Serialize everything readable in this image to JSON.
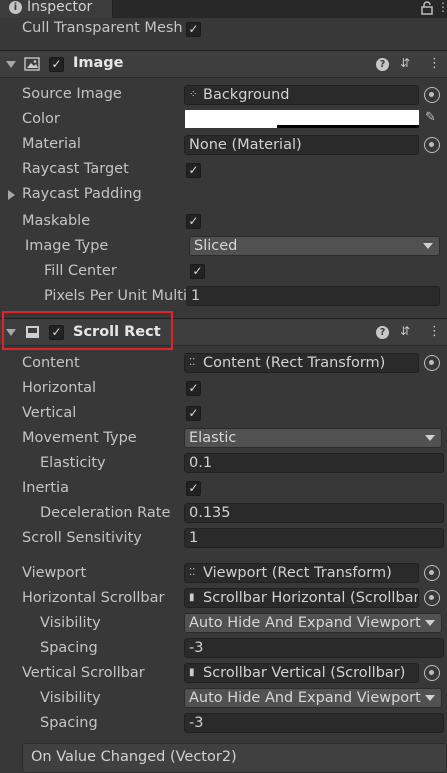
{
  "window": {
    "tab_label": "Inspector",
    "tab_icon": "info-icon",
    "lock_icon": "lock-icon",
    "menu_icon": "kebab-menu-icon"
  },
  "top": {
    "cull_label": "Cull Transparent Mesh",
    "cull_checked": true
  },
  "image_component": {
    "title": "Image",
    "enabled": true,
    "source_image_label": "Source Image",
    "source_image_value": "Background",
    "color_label": "Color",
    "color_value": "#ffffff",
    "material_label": "Material",
    "material_value": "None (Material)",
    "raycast_target_label": "Raycast Target",
    "raycast_target_checked": true,
    "raycast_padding_label": "Raycast Padding",
    "maskable_label": "Maskable",
    "maskable_checked": true,
    "image_type_label": "Image Type",
    "image_type_value": "Sliced",
    "fill_center_label": "Fill Center",
    "fill_center_checked": true,
    "ppu_label": "Pixels Per Unit Multi",
    "ppu_value": "1"
  },
  "scroll_rect": {
    "title": "Scroll Rect",
    "enabled": true,
    "content_label": "Content",
    "content_value": "Content (Rect Transform)",
    "horizontal_label": "Horizontal",
    "horizontal_checked": true,
    "vertical_label": "Vertical",
    "vertical_checked": true,
    "movement_type_label": "Movement Type",
    "movement_type_value": "Elastic",
    "elasticity_label": "Elasticity",
    "elasticity_value": "0.1",
    "inertia_label": "Inertia",
    "inertia_checked": true,
    "deceleration_label": "Deceleration Rate",
    "deceleration_value": "0.135",
    "scroll_sensitivity_label": "Scroll Sensitivity",
    "scroll_sensitivity_value": "1",
    "viewport_label": "Viewport",
    "viewport_value": "Viewport (Rect Transform)",
    "h_scrollbar_label": "Horizontal Scrollbar",
    "h_scrollbar_value": "Scrollbar Horizontal (Scrollbar)",
    "h_visibility_label": "Visibility",
    "h_visibility_value": "Auto Hide And Expand Viewport",
    "h_spacing_label": "Spacing",
    "h_spacing_value": "-3",
    "v_scrollbar_label": "Vertical Scrollbar",
    "v_scrollbar_value": "Scrollbar Vertical (Scrollbar)",
    "v_visibility_label": "Visibility",
    "v_visibility_value": "Auto Hide And Expand Viewport",
    "v_spacing_label": "Spacing",
    "v_spacing_value": "-3",
    "event_label": "On Value Changed (Vector2)"
  },
  "colors": {
    "panel_bg": "#383838",
    "header_bg": "#3e3e3e",
    "field_bg": "#2a2a2a",
    "dropdown_bg": "#515151",
    "highlight": "#e0242a"
  }
}
